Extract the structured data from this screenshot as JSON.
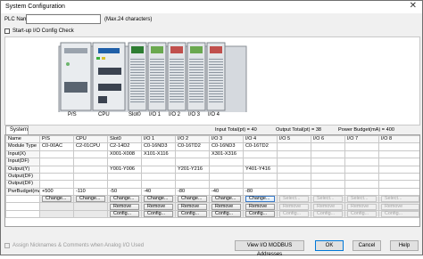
{
  "window": {
    "title": "System Configuration",
    "close": "✕"
  },
  "plc": {
    "name_label": "PLC Name",
    "name_value": "",
    "max_note": "(Max.24 characters)"
  },
  "startup_check": {
    "label": "Start-up I/O Config Check",
    "checked": false
  },
  "rack": {
    "slot_labels": [
      "P/S",
      "CPU",
      "Slot0",
      "I/O 1",
      "I/O 2",
      "I/O 3",
      "I/O 4"
    ],
    "module_names": [
      "C0-00AC",
      "C2-01CPU",
      "C2-14D2",
      "C0-16ND3",
      "C0-16TD2",
      "C0-16ND3",
      "C0-16TD2"
    ]
  },
  "tabs": [
    "System"
  ],
  "totals": {
    "input": "Input Total(pt) = 40",
    "output": "Output Total(pt) = 38",
    "power": "Power Budget(mA) = 400"
  },
  "grid": {
    "columns": [
      "Name",
      "P/S",
      "CPU",
      "Slot0",
      "I/O 1",
      "I/O 2",
      "I/O 3",
      "I/O 4",
      "I/O 5",
      "I/O 6",
      "I/O 7",
      "I/O 8"
    ],
    "rows": [
      [
        "Module Type",
        "C0-00AC",
        "C2-01CPU",
        "C2-14D2",
        "C0-16ND3",
        "C0-16TD2",
        "C0-16ND3",
        "C0-16TD2",
        "",
        "",
        "",
        ""
      ],
      [
        "Input(X)",
        "",
        "",
        "X001-X008",
        "X101-X116",
        "",
        "X301-X316",
        "",
        "",
        "",
        "",
        ""
      ],
      [
        "Input(DF)",
        "",
        "",
        "",
        "",
        "",
        "",
        "",
        "",
        "",
        "",
        ""
      ],
      [
        "Output(Y)",
        "",
        "",
        "Y001-Y006",
        "",
        "Y201-Y216",
        "",
        "Y401-Y416",
        "",
        "",
        "",
        ""
      ],
      [
        "Output(DF)",
        "",
        "",
        "",
        "",
        "",
        "",
        "",
        "",
        "",
        "",
        ""
      ],
      [
        "Output(DF)",
        "",
        "",
        "",
        "",
        "",
        "",
        "",
        "",
        "",
        "",
        ""
      ],
      [
        "PwrBudget(mA)",
        "+500",
        "-110",
        "-50",
        "-40",
        "-80",
        "-40",
        "-80",
        "",
        "",
        "",
        ""
      ]
    ],
    "btn_row_change": [
      "Change...",
      "Change...",
      "Change...",
      "Change...",
      "Change...",
      "Change...",
      "Change...",
      "Select...",
      "Select...",
      "Select...",
      "Select..."
    ],
    "btn_row_remove": [
      "",
      "",
      "Remove",
      "Remove",
      "Remove",
      "Remove",
      "Remove",
      "Remove",
      "Remove",
      "Remove",
      "Remove"
    ],
    "btn_row_config": [
      "",
      "",
      "Config...",
      "Config...",
      "Config...",
      "Config...",
      "Config...",
      "Config...",
      "Config...",
      "Config...",
      "Config..."
    ]
  },
  "footer": {
    "assign_check": "Assign Nicknames & Comments when Analog I/O Used",
    "modbus_btn": "View I/O MODBUS Addresses",
    "ok": "OK",
    "cancel": "Cancel",
    "help": "Help"
  }
}
